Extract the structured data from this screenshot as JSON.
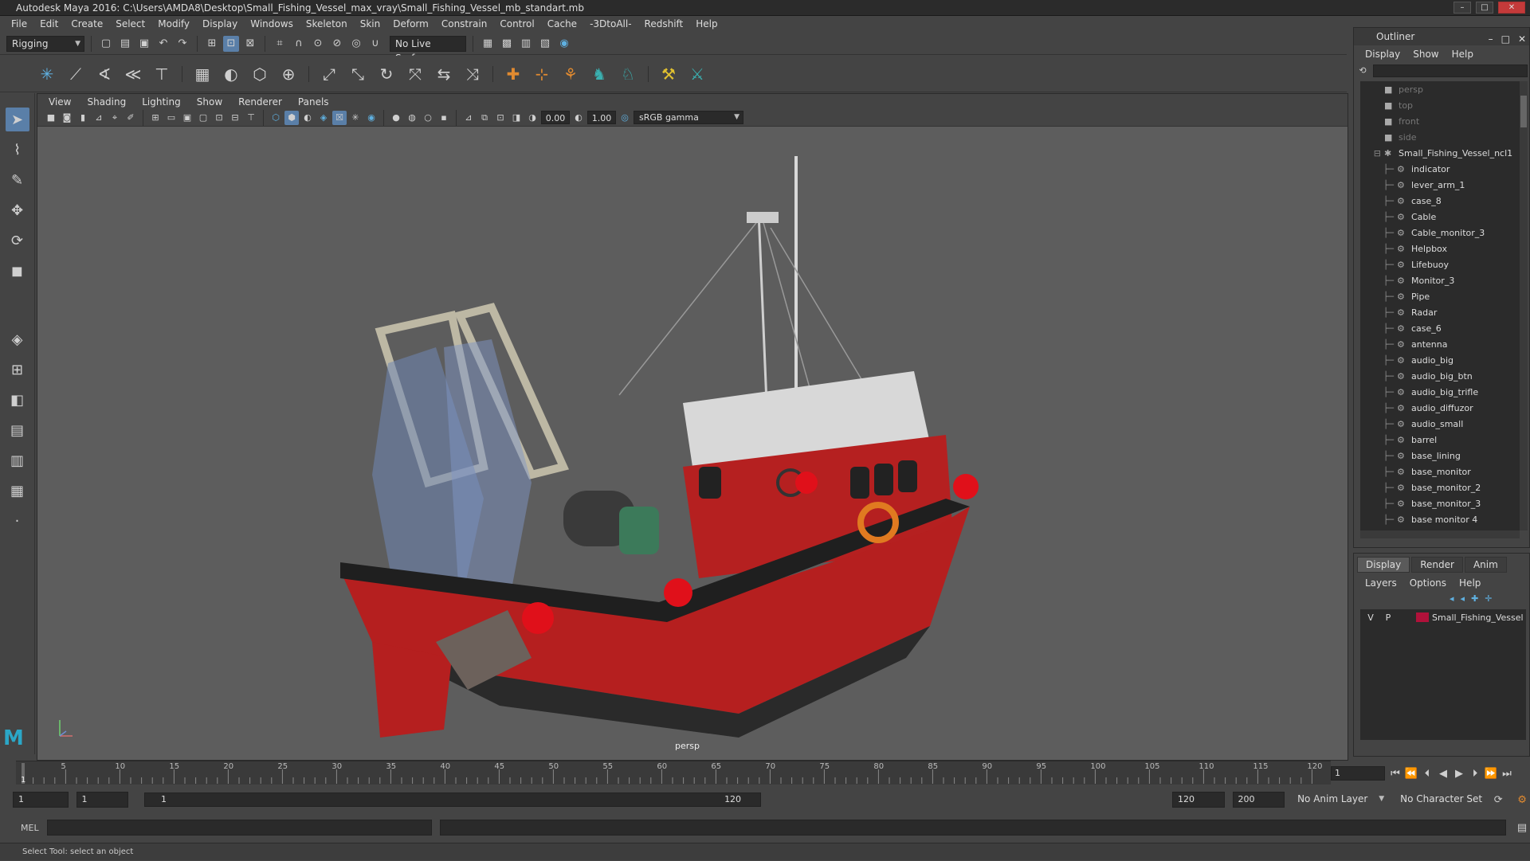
{
  "window": {
    "title": "Autodesk Maya 2016: C:\\Users\\AMDA8\\Desktop\\Small_Fishing_Vessel_max_vray\\Small_Fishing_Vessel_mb_standart.mb"
  },
  "menus": [
    "File",
    "Edit",
    "Create",
    "Select",
    "Modify",
    "Display",
    "Windows",
    "Skeleton",
    "Skin",
    "Deform",
    "Constrain",
    "Control",
    "Cache",
    "-3DtoAll-",
    "Redshift",
    "Help"
  ],
  "status_line": {
    "menuset": "Rigging",
    "live_surface": "No Live Surface"
  },
  "panel_menus": [
    "View",
    "Shading",
    "Lighting",
    "Show",
    "Renderer",
    "Panels"
  ],
  "panel_toolbar": {
    "exposure": "0.00",
    "gamma": "1.00",
    "color_space": "sRGB gamma"
  },
  "viewport": {
    "camera_label": "persp"
  },
  "outliner": {
    "title": "Outliner",
    "menus": [
      "Display",
      "Show",
      "Help"
    ],
    "cameras": [
      "persp",
      "top",
      "front",
      "side"
    ],
    "root": "Small_Fishing_Vessel_ncl1",
    "children": [
      "indicator",
      "lever_arm_1",
      "case_8",
      "Cable",
      "Cable_monitor_3",
      "Helpbox",
      "Lifebuoy",
      "Monitor_3",
      "Pipe",
      "Radar",
      "case_6",
      "antenna",
      "audio_big",
      "audio_big_btn",
      "audio_big_trifle",
      "audio_diffuzor",
      "audio_small",
      "barrel",
      "base_lining",
      "base_monitor",
      "base_monitor_2",
      "base_monitor_3",
      "base monitor 4"
    ]
  },
  "layer_editor": {
    "tabs": [
      "Display",
      "Render",
      "Anim"
    ],
    "menus": [
      "Layers",
      "Options",
      "Help"
    ],
    "layers": [
      {
        "v": "V",
        "p": "P",
        "name": "Small_Fishing_Vessel",
        "color": "#b0113a"
      }
    ]
  },
  "timeline": {
    "ticks": [
      "5",
      "10",
      "15",
      "20",
      "25",
      "30",
      "35",
      "40",
      "45",
      "50",
      "55",
      "60",
      "65",
      "70",
      "75",
      "80",
      "85",
      "90",
      "95",
      "100",
      "105",
      "110",
      "115",
      "120"
    ],
    "current_marker": "1",
    "current_frame": "1"
  },
  "range": {
    "start": "1",
    "playback_start": "1",
    "slider_start": "1",
    "slider_end": "120",
    "playback_end": "120",
    "end": "200",
    "anim_layer": "No Anim Layer",
    "character_set": "No Character Set"
  },
  "command_line": {
    "language": "MEL"
  },
  "help_line": "Select Tool: select an object"
}
